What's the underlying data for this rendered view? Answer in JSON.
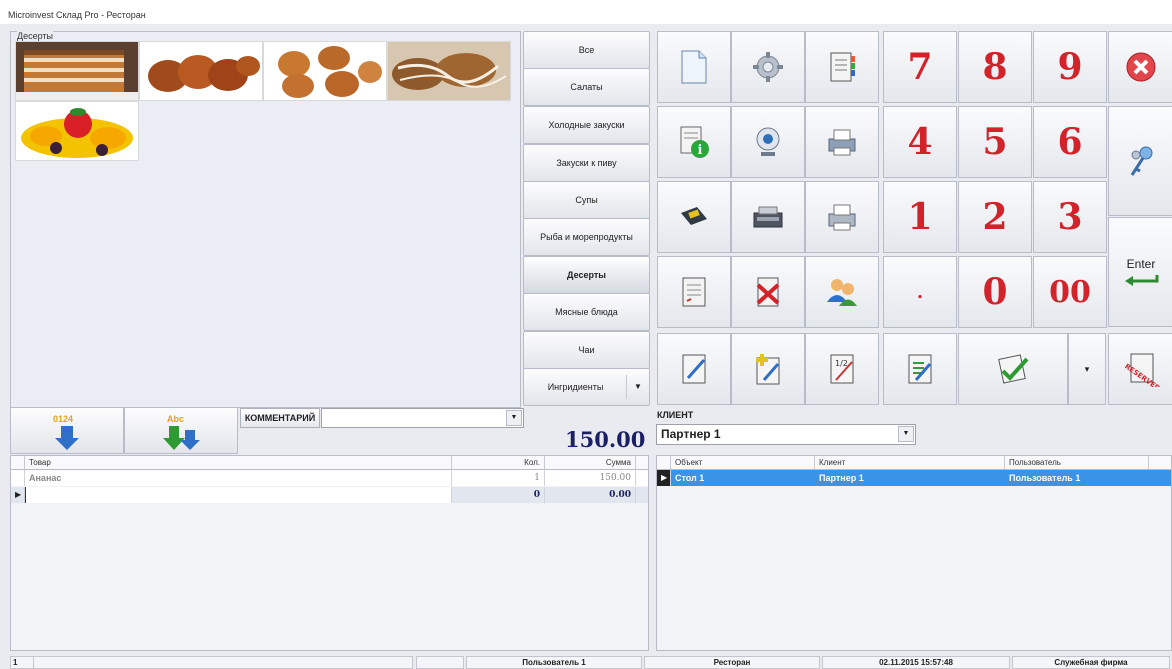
{
  "window": {
    "title": "Microinvest Склад Pro - Ресторан"
  },
  "gallery": {
    "label": "Десерты"
  },
  "categories": [
    {
      "label": "Все"
    },
    {
      "label": "Салаты"
    },
    {
      "label": "Холодные закуски"
    },
    {
      "label": "Закуски к пиву"
    },
    {
      "label": "Супы"
    },
    {
      "label": "Рыба и морепродукты"
    },
    {
      "label": "Десерты",
      "active": true
    },
    {
      "label": "Мясные блюда"
    },
    {
      "label": "Чаи"
    },
    {
      "label": "Ингридиенты"
    }
  ],
  "keypad": {
    "digits": [
      "7",
      "8",
      "9",
      "4",
      "5",
      "6",
      "1",
      "2",
      "3",
      ".",
      "0",
      "00"
    ],
    "enter_label": "Enter"
  },
  "order": {
    "numeric_sort_label": "0124",
    "alpha_sort_label": "Abc",
    "comment_label": "КОММЕНТАРИЙ",
    "comment_value": "",
    "total": "150.00",
    "columns": [
      "Товар",
      "Кол.",
      "Сумма"
    ],
    "rows": [
      {
        "item": "Ананас",
        "qty": "1",
        "sum": "150.00"
      }
    ],
    "totals": {
      "qty": "0",
      "sum": "0.00"
    }
  },
  "client": {
    "label": "КЛИЕНТ",
    "selected": "Партнер 1",
    "columns": [
      "Объект",
      "Клиент",
      "Пользователь"
    ],
    "rows": [
      {
        "object": "Стол 1",
        "client": "Партнер 1",
        "user": "Пользователь 1"
      }
    ]
  },
  "status": {
    "page": "1",
    "user": "Пользователь 1",
    "mode": "Ресторан",
    "datetime": "02.11.2015 15:57:48",
    "company": "Служебная фирма"
  },
  "colors": {
    "accent_red": "#d2232a",
    "selection_blue": "#3a93e6",
    "total_navy": "#1a1f66"
  }
}
